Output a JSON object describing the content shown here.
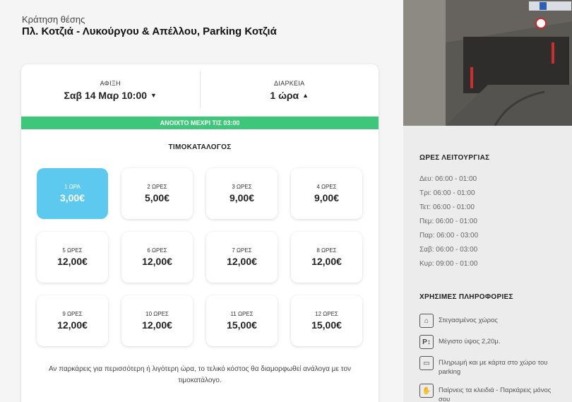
{
  "header": {
    "subtitle": "Κράτηση θέσης",
    "title": "Πλ. Κοτζιά - Λυκούργου & Απέλλου, Parking Κοτζιά"
  },
  "booking": {
    "arrival_label": "ΑΦΙΞΗ",
    "arrival_value": "Σαβ 14 Μαρ 10:00",
    "duration_label": "ΔΙΑΡΚΕΙΑ",
    "duration_value": "1 ώρα",
    "open_status": "ΑΝΟΙΧΤΟ ΜΕΧΡΙ ΤΙΣ 03:00"
  },
  "pricelist": {
    "title": "ΤΙΜΟΚΑΤΑΛΟΓΟΣ",
    "tiles": [
      {
        "label": "1 ΩΡΑ",
        "price": "3,00€",
        "selected": true
      },
      {
        "label": "2 ΩΡΕΣ",
        "price": "5,00€"
      },
      {
        "label": "3 ΩΡΕΣ",
        "price": "9,00€"
      },
      {
        "label": "4 ΩΡΕΣ",
        "price": "9,00€"
      },
      {
        "label": "5 ΩΡΕΣ",
        "price": "12,00€"
      },
      {
        "label": "6 ΩΡΕΣ",
        "price": "12,00€"
      },
      {
        "label": "7 ΩΡΕΣ",
        "price": "12,00€"
      },
      {
        "label": "8 ΩΡΕΣ",
        "price": "12,00€"
      },
      {
        "label": "9 ΩΡΕΣ",
        "price": "12,00€"
      },
      {
        "label": "10 ΩΡΕΣ",
        "price": "12,00€"
      },
      {
        "label": "11 ΩΡΕΣ",
        "price": "15,00€"
      },
      {
        "label": "12 ΩΡΕΣ",
        "price": "15,00€"
      }
    ],
    "note": "Αν παρκάρεις για περισσότερη ή λιγότερη ώρα, το τελικό κόστος θα διαμορφωθεί ανάλογα με τον τιμοκατάλογο."
  },
  "sidebar": {
    "hours_title": "ΩΡΕΣ ΛΕΙΤΟΥΡΓΙΑΣ",
    "hours": [
      "Δευ: 06:00 - 01:00",
      "Τρι: 06:00 - 01:00",
      "Τετ: 06:00 - 01:00",
      "Πεμ: 06:00 - 01:00",
      "Παρ: 06:00 - 03:00",
      "Σαβ: 06:00 - 03:00",
      "Κυρ: 09:00 - 01:00"
    ],
    "info_title": "ΧΡΗΣΙΜΕΣ ΠΛΗΡΟΦΟΡΙΕΣ",
    "info": [
      {
        "icon": "covered-garage-icon",
        "glyph": "⌂",
        "text": "Στεγασμένος χώρος"
      },
      {
        "icon": "height-limit-icon",
        "glyph": "P↕",
        "text": "Μέγιστο ύψος 2,20μ."
      },
      {
        "icon": "card-payment-icon",
        "glyph": "▭",
        "text": "Πληρωμή και με κάρτα στο χώρο του parking"
      },
      {
        "icon": "self-park-key-icon",
        "glyph": "✋",
        "text": "Παίρνεις τα κλειδιά - Παρκάρεις μόνος σου"
      }
    ]
  },
  "colors": {
    "accent_green": "#3ec77a",
    "selected_tile": "#5ec9ee"
  }
}
